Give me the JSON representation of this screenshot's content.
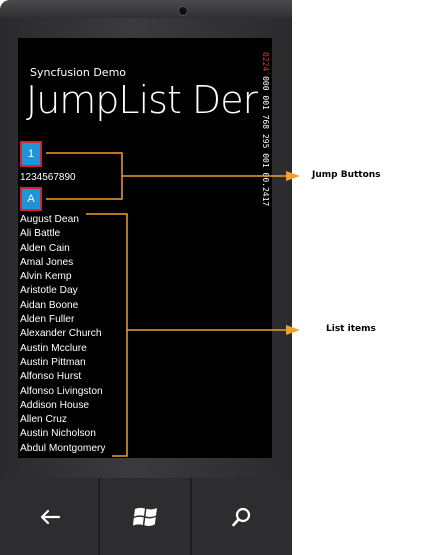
{
  "app": {
    "name": "Syncfusion Demo",
    "title": "JumpList Demo"
  },
  "counters": {
    "top": "0224",
    "line1": "000",
    "line2": "001",
    "line3": "768",
    "line4": "295",
    "line5": "001",
    "line6": "00.2417"
  },
  "jump_buttons": [
    {
      "label": "1"
    },
    {
      "label": "A"
    }
  ],
  "jump_group_text": "1234567890",
  "list_items": [
    "August Dean",
    "Ali Battle",
    "Alden Cain",
    "Amal Jones",
    "Alvin Kemp",
    "Aristotle Day",
    "Aidan Boone",
    "Alden Fuller",
    "Alexander Church",
    "Austin Mcclure",
    "Austin Pittman",
    "Alfonso Hurst",
    "Alfonso Livingston",
    "Addison House",
    "Allen Cruz",
    "Austin Nicholson",
    "Abdul Montgomery"
  ],
  "annotations": {
    "jump_buttons": "Jump Buttons",
    "list_items": "List items"
  },
  "navbar": {
    "back_icon": "back-arrow-icon",
    "start_icon": "windows-logo-icon",
    "search_icon": "search-icon"
  },
  "colors": {
    "accent": "#1f95d8",
    "highlight_border": "#d6242a",
    "callout_line": "#f0a030"
  }
}
